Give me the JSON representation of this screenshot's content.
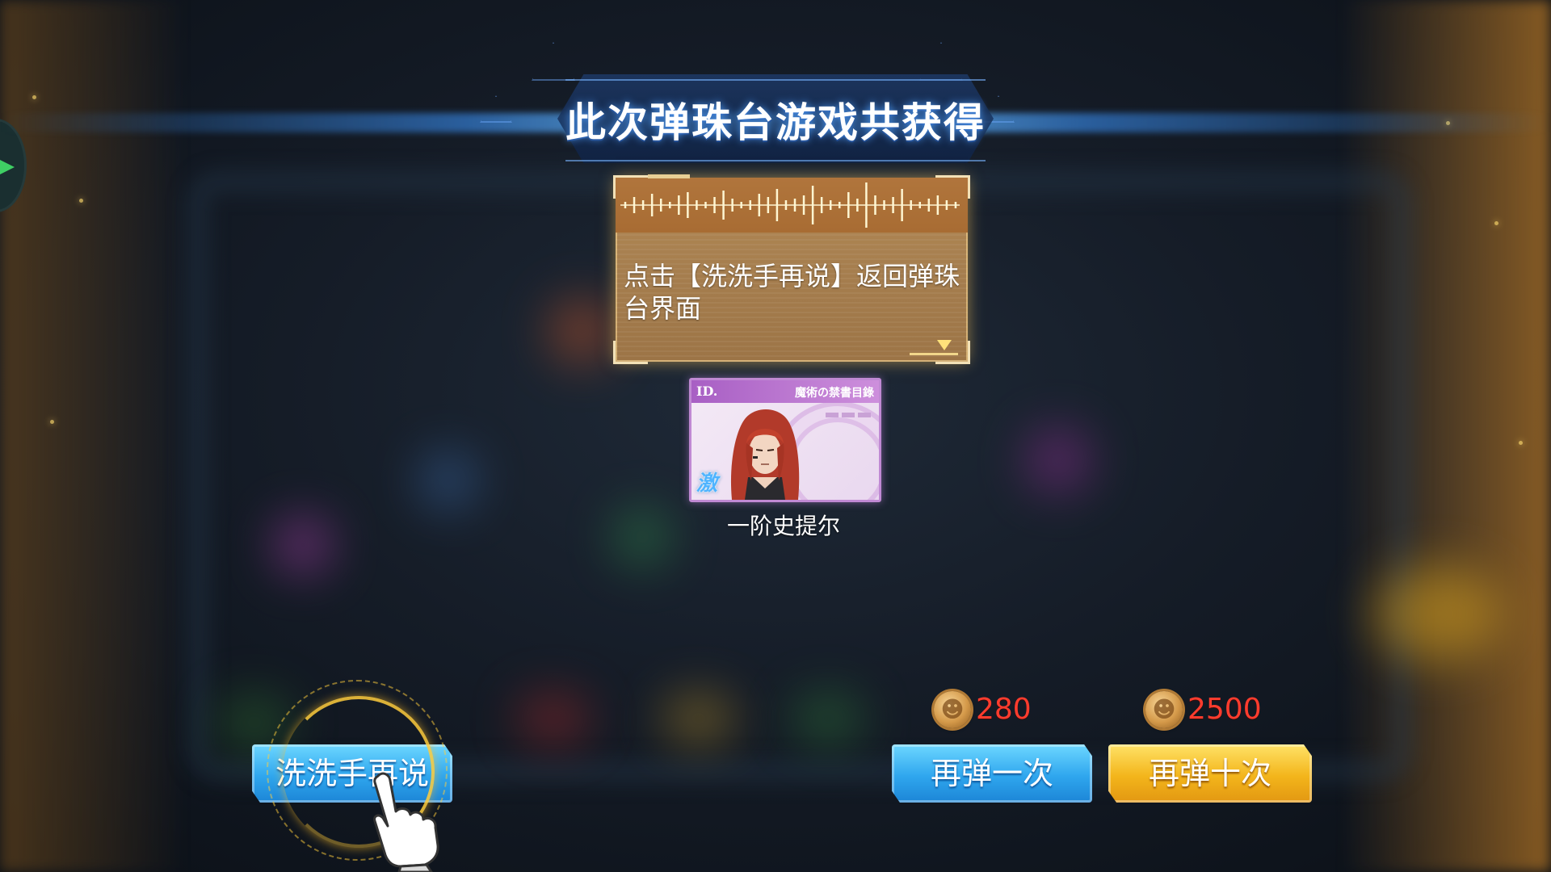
{
  "title": "此次弹珠台游戏共获得",
  "dialog": {
    "message": "点击【洗洗手再说】返回弹珠台界面"
  },
  "reward": {
    "card_id_label": "ID.",
    "card_series": "魔術の禁書目錄",
    "card_badge": "激",
    "name": "一阶史提尔"
  },
  "buttons": {
    "shuffle_label": "洗洗手再说",
    "once_label": "再弹一次",
    "ten_label": "再弹十次"
  },
  "costs": {
    "once": "280",
    "ten": "2500"
  },
  "colors": {
    "blue_button": "#2fa6ee",
    "gold_button": "#f3b51b",
    "cost_text": "#ff3c2e",
    "dialog_bg": "#a77f4f",
    "card_border": "#c089d3"
  },
  "icons": {
    "currency": "coin-icon",
    "tutorial": "pointing-hand-icon",
    "dialog_next": "triangle-down-icon"
  }
}
